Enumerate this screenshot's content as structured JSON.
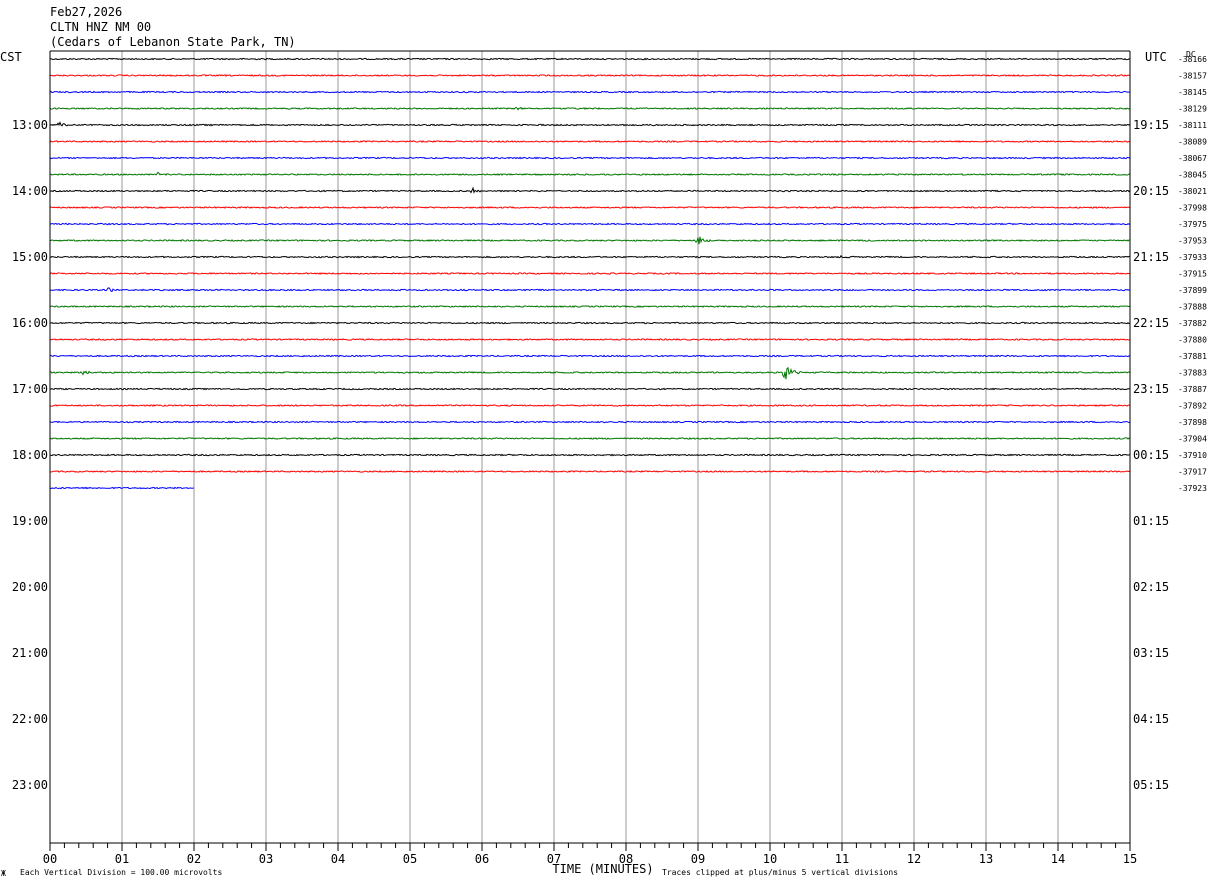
{
  "header": {
    "date": "Feb27,2026",
    "station": "CLTN HNZ NM 00",
    "location": "(Cedars of Lebanon State Park, TN)"
  },
  "left_tz": "CST",
  "right_tz": "UTC",
  "dc_label": "DC",
  "footer": {
    "marker": "Ж",
    "scale": "Each Vertical Division =  100.00 microvolts",
    "clip": "Traces clipped at plus/minus 5 vertical divisions"
  },
  "colors": {
    "trace_cycle": [
      "#000000",
      "#ff0000",
      "#0000ff",
      "#007700"
    ],
    "grid": "#999999",
    "frame": "#000000"
  },
  "chart_data": {
    "type": "line",
    "title": "Feb27,2026 CLTN HNZ NM 00 (Cedars of Lebanon State Park, TN)",
    "xlabel": "TIME (MINUTES)",
    "ylabel": "",
    "x_ticks": [
      "00",
      "01",
      "02",
      "03",
      "04",
      "05",
      "06",
      "07",
      "08",
      "09",
      "10",
      "11",
      "12",
      "13",
      "14",
      "15"
    ],
    "xlim": [
      0,
      15
    ],
    "minutes_per_row": 15,
    "row_count": 48,
    "left_hour_labels": [
      "13:00",
      "14:00",
      "15:00",
      "16:00",
      "17:00",
      "18:00",
      "19:00",
      "20:00",
      "21:00",
      "22:00",
      "23:00"
    ],
    "right_hour_labels": [
      "19:15",
      "20:15",
      "21:15",
      "22:15",
      "23:15",
      "00:15",
      "01:15",
      "02:15",
      "03:15",
      "04:15",
      "05:15"
    ],
    "first_labeled_row": 4,
    "traces": [
      {
        "dc": "-38166",
        "end_minute": 15
      },
      {
        "dc": "-38157",
        "end_minute": 15
      },
      {
        "dc": "-38145",
        "end_minute": 15
      },
      {
        "dc": "-38129",
        "end_minute": 15,
        "events": [
          {
            "minute": 6.5,
            "amp": 2
          }
        ]
      },
      {
        "dc": "-38111",
        "end_minute": 15,
        "events": [
          {
            "minute": 0.1,
            "amp": 7
          }
        ]
      },
      {
        "dc": "-38089",
        "end_minute": 15
      },
      {
        "dc": "-38067",
        "end_minute": 15
      },
      {
        "dc": "-38045",
        "end_minute": 15,
        "events": [
          {
            "minute": 1.5,
            "amp": 2
          }
        ]
      },
      {
        "dc": "-38021",
        "end_minute": 15,
        "events": [
          {
            "minute": 5.85,
            "amp": 4
          }
        ]
      },
      {
        "dc": "-37998",
        "end_minute": 15
      },
      {
        "dc": "-37975",
        "end_minute": 15
      },
      {
        "dc": "-37953",
        "end_minute": 15,
        "events": [
          {
            "minute": 9.0,
            "amp": 6
          }
        ]
      },
      {
        "dc": "-37933",
        "end_minute": 15,
        "events": [
          {
            "minute": 11.0,
            "amp": 2
          }
        ]
      },
      {
        "dc": "-37915",
        "end_minute": 15
      },
      {
        "dc": "-37899",
        "end_minute": 15,
        "events": [
          {
            "minute": 0.8,
            "amp": 3
          }
        ]
      },
      {
        "dc": "-37888",
        "end_minute": 15
      },
      {
        "dc": "-37882",
        "end_minute": 15
      },
      {
        "dc": "-37880",
        "end_minute": 15
      },
      {
        "dc": "-37881",
        "end_minute": 15
      },
      {
        "dc": "-37883",
        "end_minute": 15,
        "events": [
          {
            "minute": 0.45,
            "amp": 3
          },
          {
            "minute": 10.2,
            "amp": 14
          }
        ]
      },
      {
        "dc": "-37887",
        "end_minute": 15
      },
      {
        "dc": "-37892",
        "end_minute": 15
      },
      {
        "dc": "-37898",
        "end_minute": 15
      },
      {
        "dc": "-37904",
        "end_minute": 15
      },
      {
        "dc": "-37910",
        "end_minute": 15
      },
      {
        "dc": "-37917",
        "end_minute": 15
      },
      {
        "dc": "-37923",
        "end_minute": 2
      }
    ]
  }
}
